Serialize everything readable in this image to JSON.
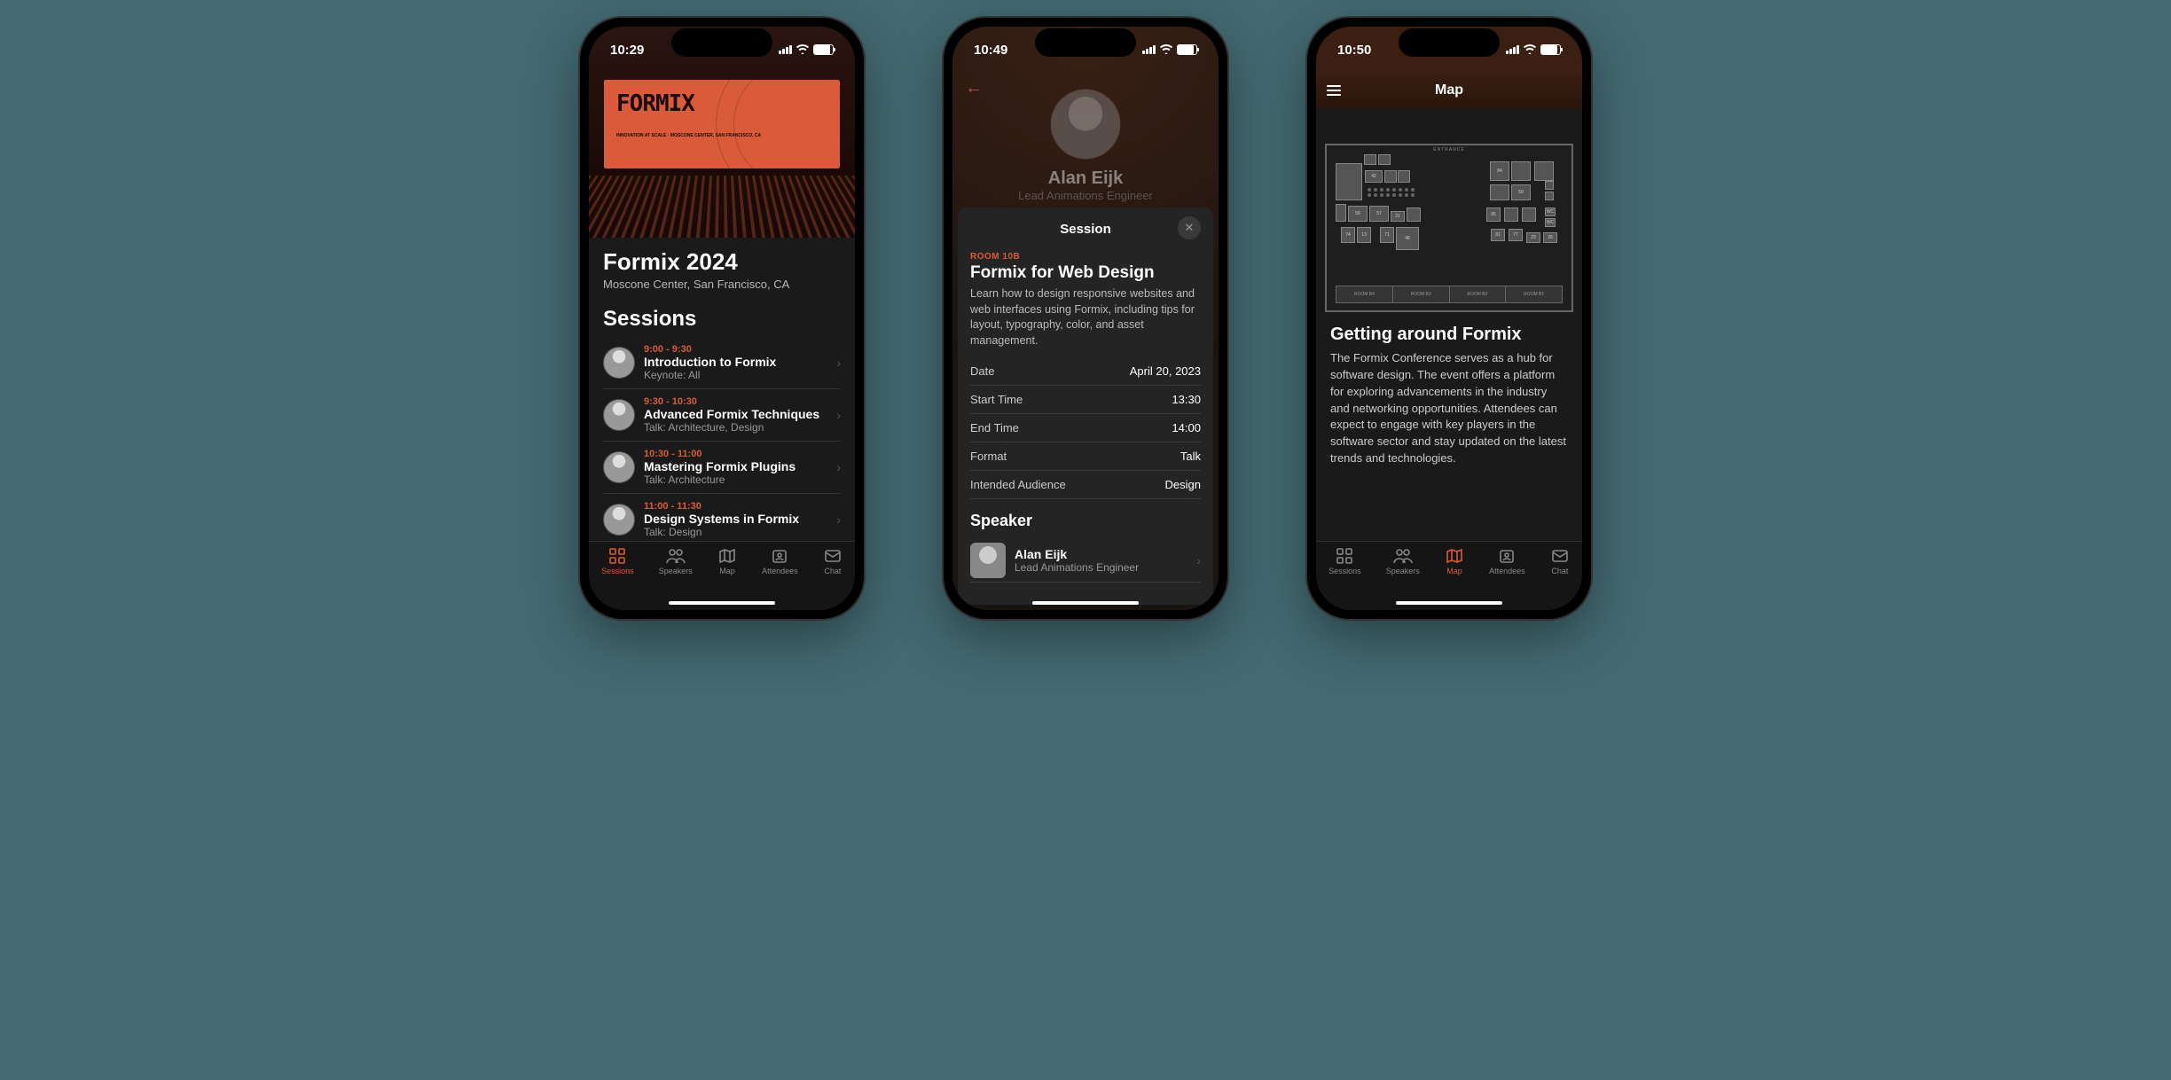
{
  "phone1": {
    "time": "10:29",
    "banner_logo": "FORMIX",
    "banner_subtitle": "INNOVATION AT SCALE · MOSCONE CENTER, SAN FRANCISCO, CA",
    "event_title": "Formix 2024",
    "event_location": "Moscone Center, San Francisco, CA",
    "sessions_heading": "Sessions",
    "sessions": [
      {
        "time": "9:00 - 9:30",
        "title": "Introduction to Formix",
        "meta": "Keynote:  All"
      },
      {
        "time": "9:30 - 10:30",
        "title": "Advanced Formix Techniques",
        "meta": "Talk:  Architecture, Design"
      },
      {
        "time": "10:30 - 11:00",
        "title": "Mastering Formix Plugins",
        "meta": "Talk:  Architecture"
      },
      {
        "time": "11:00 - 11:30",
        "title": "Design Systems in Formix",
        "meta": "Talk:  Design"
      }
    ],
    "tabs": [
      "Sessions",
      "Speakers",
      "Map",
      "Attendees",
      "Chat"
    ],
    "active_tab": "Sessions"
  },
  "phone2": {
    "time": "10:49",
    "profile_name": "Alan Eijk",
    "profile_role": "Lead Animations Engineer",
    "sheet_title": "Session",
    "room": "ROOM 10B",
    "session_title": "Formix for Web Design",
    "session_desc": "Learn how to design responsive websites and web interfaces using Formix, including tips for layout, typography, color, and asset management.",
    "details": {
      "date_k": "Date",
      "date_v": "April 20, 2023",
      "start_k": "Start Time",
      "start_v": "13:30",
      "end_k": "End Time",
      "end_v": "14:00",
      "format_k": "Format",
      "format_v": "Talk",
      "aud_k": "Intended Audience",
      "aud_v": "Design"
    },
    "speaker_heading": "Speaker",
    "speaker_name": "Alan Eijk",
    "speaker_role": "Lead Animations Engineer"
  },
  "phone3": {
    "time": "10:50",
    "nav_title": "Map",
    "entrance_label": "ENTRANCE",
    "bottom_rooms": [
      "ROOM B4",
      "ROOM B3",
      "ROOM B2",
      "ROOM B1"
    ],
    "heading": "Getting around Formix",
    "body": "The Formix Conference serves as a hub for software design. The event offers a platform for exploring advancements in the industry and networking opportunities. Attendees can expect to engage with key players in the software sector and stay updated on the latest trends and technologies.",
    "tabs": [
      "Sessions",
      "Speakers",
      "Map",
      "Attendees",
      "Chat"
    ],
    "active_tab": "Map"
  },
  "colors": {
    "accent": "#d95b3a"
  }
}
